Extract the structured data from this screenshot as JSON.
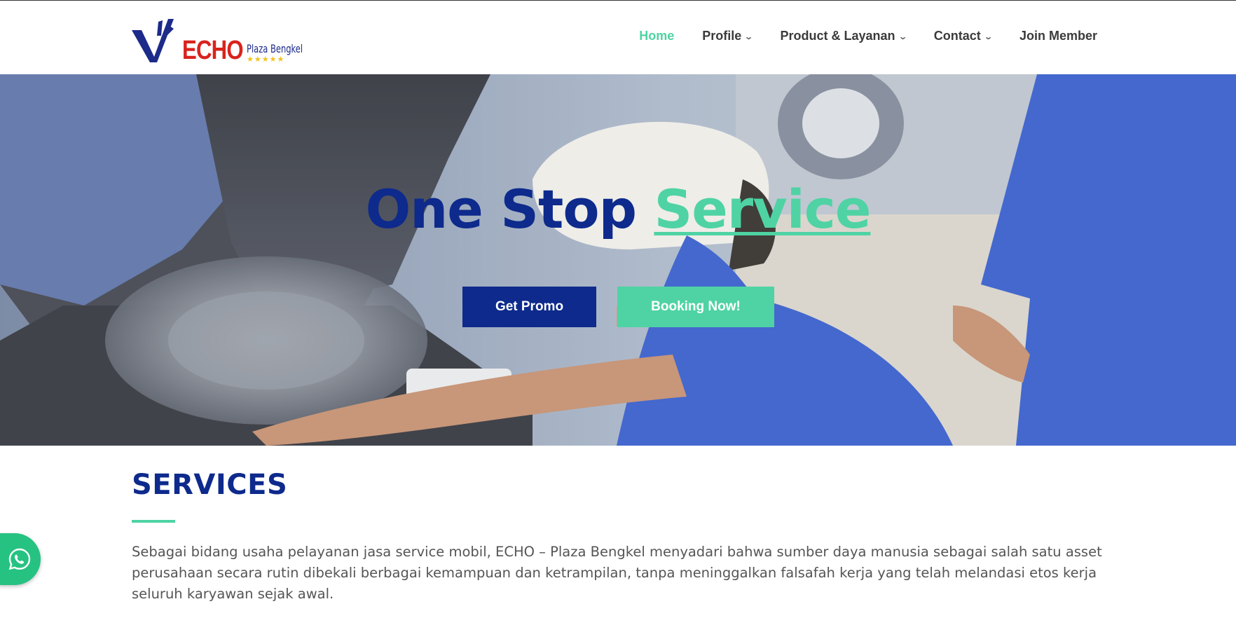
{
  "brand": {
    "logo_mark": "ECHO",
    "logo_subtitle": "Plaza Bengkel",
    "logo_stars": "★★★★★",
    "primary_color": "#0d2a8c",
    "accent_color": "#4fd3a4",
    "logo_red": "#d9231d"
  },
  "nav": {
    "items": [
      {
        "label": "Home",
        "active": true,
        "dropdown": false
      },
      {
        "label": "Profile",
        "dropdown": true
      },
      {
        "label": "Product & Layanan",
        "dropdown": true
      },
      {
        "label": "Contact",
        "dropdown": true
      },
      {
        "label": "Join Member",
        "dropdown": false
      }
    ],
    "dropdown_icon": "chevron-down-icon"
  },
  "hero": {
    "title_part1": "One Stop",
    "title_part2": "Service",
    "promo_button": "Get Promo",
    "booking_button": "Booking Now!"
  },
  "services": {
    "heading": "SERVICES",
    "body": "Sebagai bidang usaha pelayanan jasa service mobil, ECHO – Plaza Bengkel menyadari bahwa sumber daya manusia sebagai salah satu asset perusahaan secara rutin dibekali berbagai kemampuan dan ketrampilan, tanpa meninggalkan falsafah kerja yang telah melandasi etos kerja seluruh karyawan sejak awal."
  },
  "floating": {
    "whatsapp_icon": "whatsapp-icon",
    "whatsapp_color": "#26c281"
  }
}
